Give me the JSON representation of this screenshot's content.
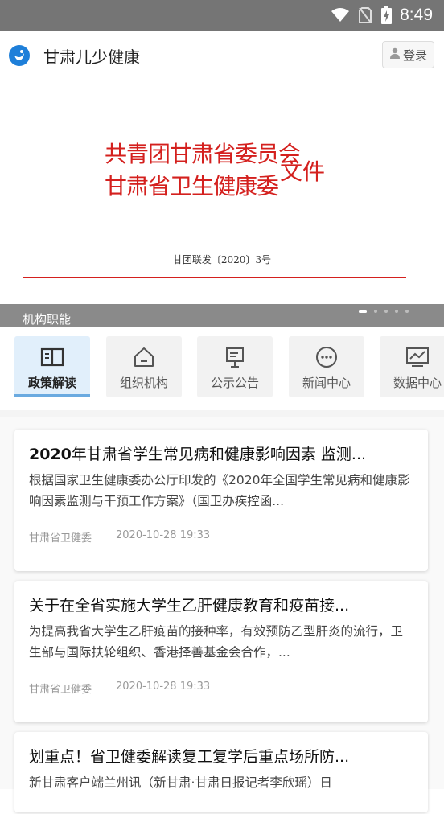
{
  "status_bar": {
    "time": "8:49"
  },
  "app_bar": {
    "title": "甘肃儿少健康",
    "login_label": "登录"
  },
  "banner": {
    "org_line_1": "共青团甘肃省委员会",
    "org_line_2": "甘肃省卫生健康委",
    "doc_suffix": "文件",
    "doc_number": "甘团联发〔2020〕3号",
    "caption": "机构职能",
    "slide_count": 5,
    "active_slide": 0
  },
  "nav": {
    "items": [
      {
        "label": "政策解读",
        "icon": "book-icon",
        "active": true
      },
      {
        "label": "组织机构",
        "icon": "home-icon",
        "active": false
      },
      {
        "label": "公示公告",
        "icon": "board-icon",
        "active": false
      },
      {
        "label": "新闻中心",
        "icon": "chat-icon",
        "active": false
      },
      {
        "label": "数据中心",
        "icon": "chart-icon",
        "active": false
      }
    ]
  },
  "articles": [
    {
      "title_bold": "2020",
      "title_rest": "年甘肃省学生常见病和健康影响因素 监测...",
      "summary": "根据国家卫生健康委办公厅印发的《2020年全国学生常见病和健康影响因素监测与干预工作方案》（国卫办疾控函...",
      "source": "甘肃省卫健委",
      "date": "2020-10-28 19:33"
    },
    {
      "title_bold": "",
      "title_rest": "关于在全省实施大学生乙肝健康教育和疫苗接...",
      "summary": "为提高我省大学生乙肝疫苗的接种率，有效预防乙型肝炎的流行，卫生部与国际扶轮组织、香港择善基金会合作，...",
      "source": "甘肃省卫健委",
      "date": "2020-10-28 19:33"
    },
    {
      "title_bold": "",
      "title_rest": "划重点！省卫健委解读复工复学后重点场所防...",
      "summary": "新甘肃客户端兰州讯（新甘肃·甘肃日报记者李欣瑶）日",
      "source": "",
      "date": ""
    }
  ]
}
